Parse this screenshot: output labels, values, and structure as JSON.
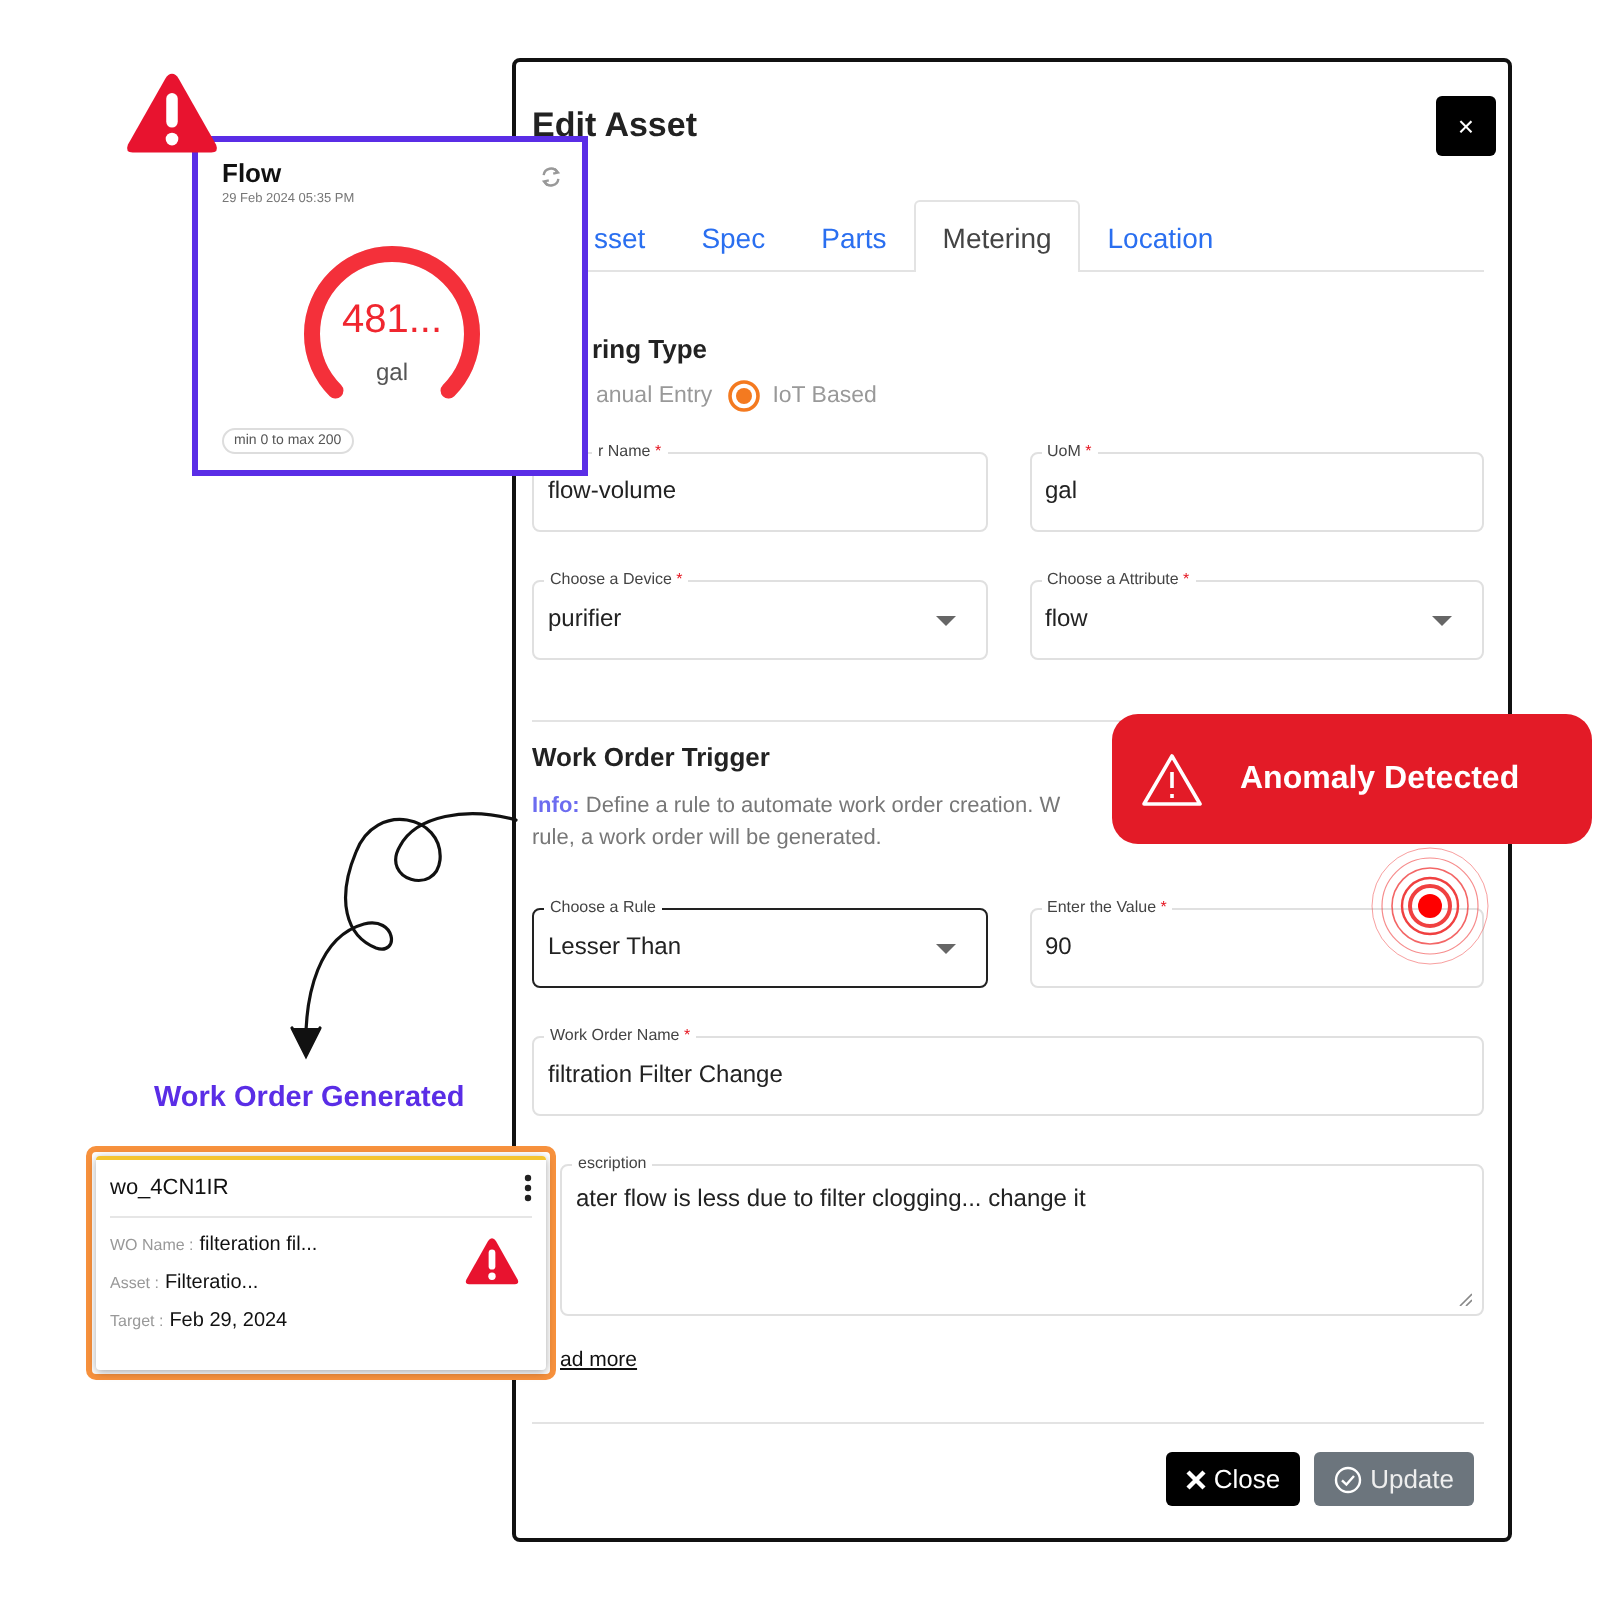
{
  "flow_widget": {
    "title": "Flow",
    "timestamp": "29 Feb 2024 05:35 PM",
    "gauge": {
      "value": "481...",
      "unit": "gal",
      "level": 1
    },
    "range": "min 0 to max 200"
  },
  "modal": {
    "title": "Edit Asset",
    "close_label": "×",
    "tabs": [
      {
        "label": "sset",
        "selected": false
      },
      {
        "label": "Spec",
        "selected": false
      },
      {
        "label": "Parts",
        "selected": false
      },
      {
        "label": "Metering",
        "selected": true
      },
      {
        "label": "Location",
        "selected": false
      }
    ],
    "metering_type": {
      "heading": "ring Type",
      "options": [
        {
          "label": "anual Entry"
        },
        {
          "label": "IoT Based",
          "selected": true
        }
      ]
    },
    "meter_fields": [
      {
        "label": "r Name",
        "required_mark": "*",
        "value": "flow-volume",
        "kind": "text",
        "focused": false
      },
      {
        "label": "UoM",
        "required_mark": "*",
        "value": "gal",
        "kind": "text",
        "focused": false
      },
      {
        "label": "Choose a Device",
        "required_mark": "*",
        "value": "purifier",
        "kind": "select",
        "focused": false
      },
      {
        "label": "Choose a Attribute",
        "required_mark": "*",
        "value": "flow",
        "kind": "select",
        "focused": false
      }
    ],
    "trigger": {
      "heading": "Work Order Trigger",
      "info_label": "Info:",
      "info_lines": [
        "Define a rule to automate work order creation. W",
        "rule, a work order will be generated."
      ],
      "fields": [
        {
          "label": "Choose a Rule",
          "value": "Lesser Than",
          "kind": "select",
          "focused": true
        },
        {
          "label": "Enter the Value",
          "required_mark": "*",
          "value": "90",
          "kind": "text",
          "focused": false
        },
        {
          "label": "Work Order Name",
          "required_mark": "*",
          "value": "filtration Filter Change",
          "kind": "text",
          "focused": false
        },
        {
          "label": "escription",
          "value": "ater flow is less due to filter clogging... change it",
          "kind": "textarea",
          "focused": false
        }
      ],
      "link": "ad more"
    },
    "buttons": [
      {
        "label": "Close",
        "kind": "dark"
      },
      {
        "label": "Update",
        "kind": "disabled"
      }
    ]
  },
  "alert": {
    "text": "Anomaly Detected"
  },
  "caption": "Work Order Generated",
  "work_order_card": {
    "id": "wo_4CN1IR",
    "rows": [
      {
        "label": "WO Name :",
        "value": "filteration fil..."
      },
      {
        "label": "Asset :",
        "value": "Filteratio..."
      },
      {
        "label": "Target :",
        "value": "Feb 29, 2024"
      }
    ]
  }
}
